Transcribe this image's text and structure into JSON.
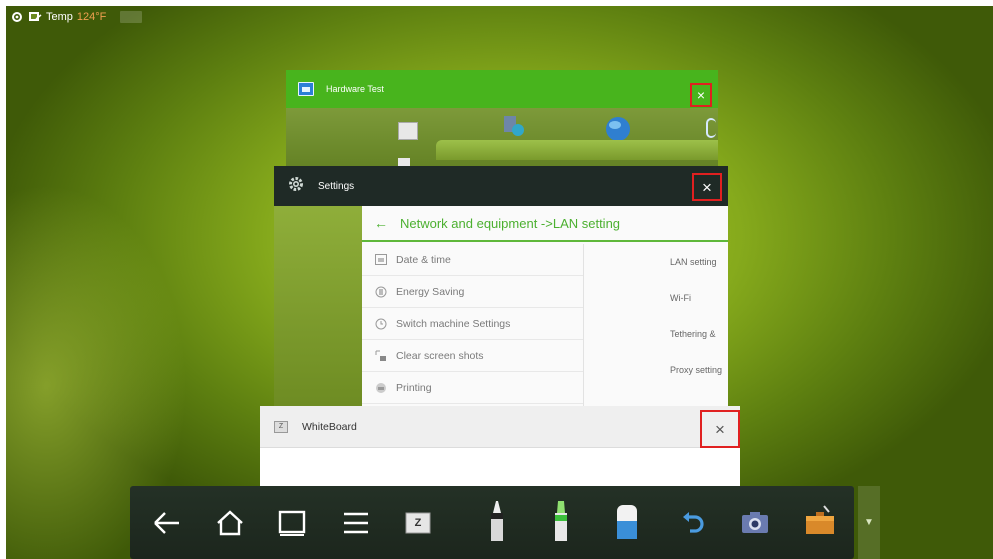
{
  "status_bar": {
    "temp_label": "Temp",
    "temp_value": "124°F",
    "icons": [
      "settings-gear-icon",
      "screen-icon"
    ]
  },
  "windows": {
    "hardware_test": {
      "title": "Hardware Test",
      "close": "×"
    },
    "settings": {
      "title": "Settings",
      "close": "×",
      "breadcrumb": "Network and equipment ->LAN setting",
      "back": "←",
      "menu_items": [
        {
          "label": "Date & time",
          "icon": "calendar-icon"
        },
        {
          "label": "Energy Saving",
          "icon": "energy-icon"
        },
        {
          "label": "Switch machine Settings",
          "icon": "clock-icon"
        },
        {
          "label": "Clear screen shots",
          "icon": "screenshot-icon"
        },
        {
          "label": "Printing",
          "icon": "printer-icon"
        }
      ],
      "right_items": [
        {
          "label": "LAN setting"
        },
        {
          "label": "Wi-Fi"
        },
        {
          "label": "Tethering &"
        },
        {
          "label": "Proxy setting"
        }
      ]
    },
    "whiteboard": {
      "title": "WhiteBoard",
      "close": "×",
      "icon_text": "Z"
    }
  },
  "dock": {
    "items": [
      "back-arrow-icon",
      "home-icon",
      "recent-apps-icon",
      "menu-icon",
      "whiteboard-icon",
      "pen-black-icon",
      "highlighter-green-icon",
      "eraser-icon",
      "undo-icon",
      "camera-icon",
      "toolbox-icon"
    ],
    "whiteboard_icon_text": "Z",
    "expand": "▼"
  },
  "colors": {
    "accent_green": "#4cb030",
    "hw_header": "#48b41d",
    "close_highlight": "#e02020",
    "dock_bg": "#1c261d"
  }
}
